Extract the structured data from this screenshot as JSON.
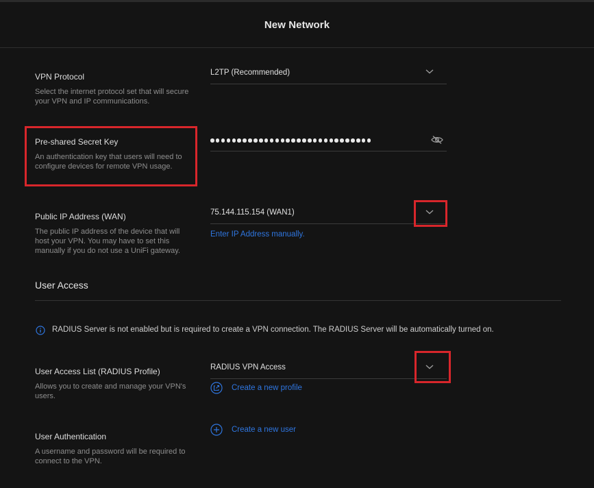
{
  "header": {
    "title": "New Network"
  },
  "vpn_protocol": {
    "label": "VPN Protocol",
    "description": "Select the internet protocol set that will secure your VPN and IP communications.",
    "value": "L2TP (Recommended)"
  },
  "psk": {
    "label": "Pre-shared Secret Key",
    "description": "An authentication key that users will need to configure devices for remote VPN usage.",
    "masked_length": 30
  },
  "public_ip": {
    "label": "Public IP Address (WAN)",
    "description": "The public IP address of the device that will host your VPN. You may have to set this manually if you do not use a UniFi gateway.",
    "value": "75.144.115.154 (WAN1)",
    "manual_link": "Enter IP Address manually."
  },
  "user_access": {
    "section_title": "User Access",
    "info": "RADIUS Server is not enabled but is required to create a VPN connection. The RADIUS Server will be automatically turned on.",
    "access_list": {
      "label": "User Access List (RADIUS Profile)",
      "description": "Allows you to create and manage your VPN's users.",
      "value": "RADIUS VPN Access",
      "create_link": "Create a new profile"
    },
    "authentication": {
      "label": "User Authentication",
      "description": "A username and password will be required to connect to the VPN.",
      "create_link": "Create a new user"
    }
  },
  "colors": {
    "background": "#141414",
    "link": "#2f76e0",
    "highlight": "#d8262b"
  }
}
